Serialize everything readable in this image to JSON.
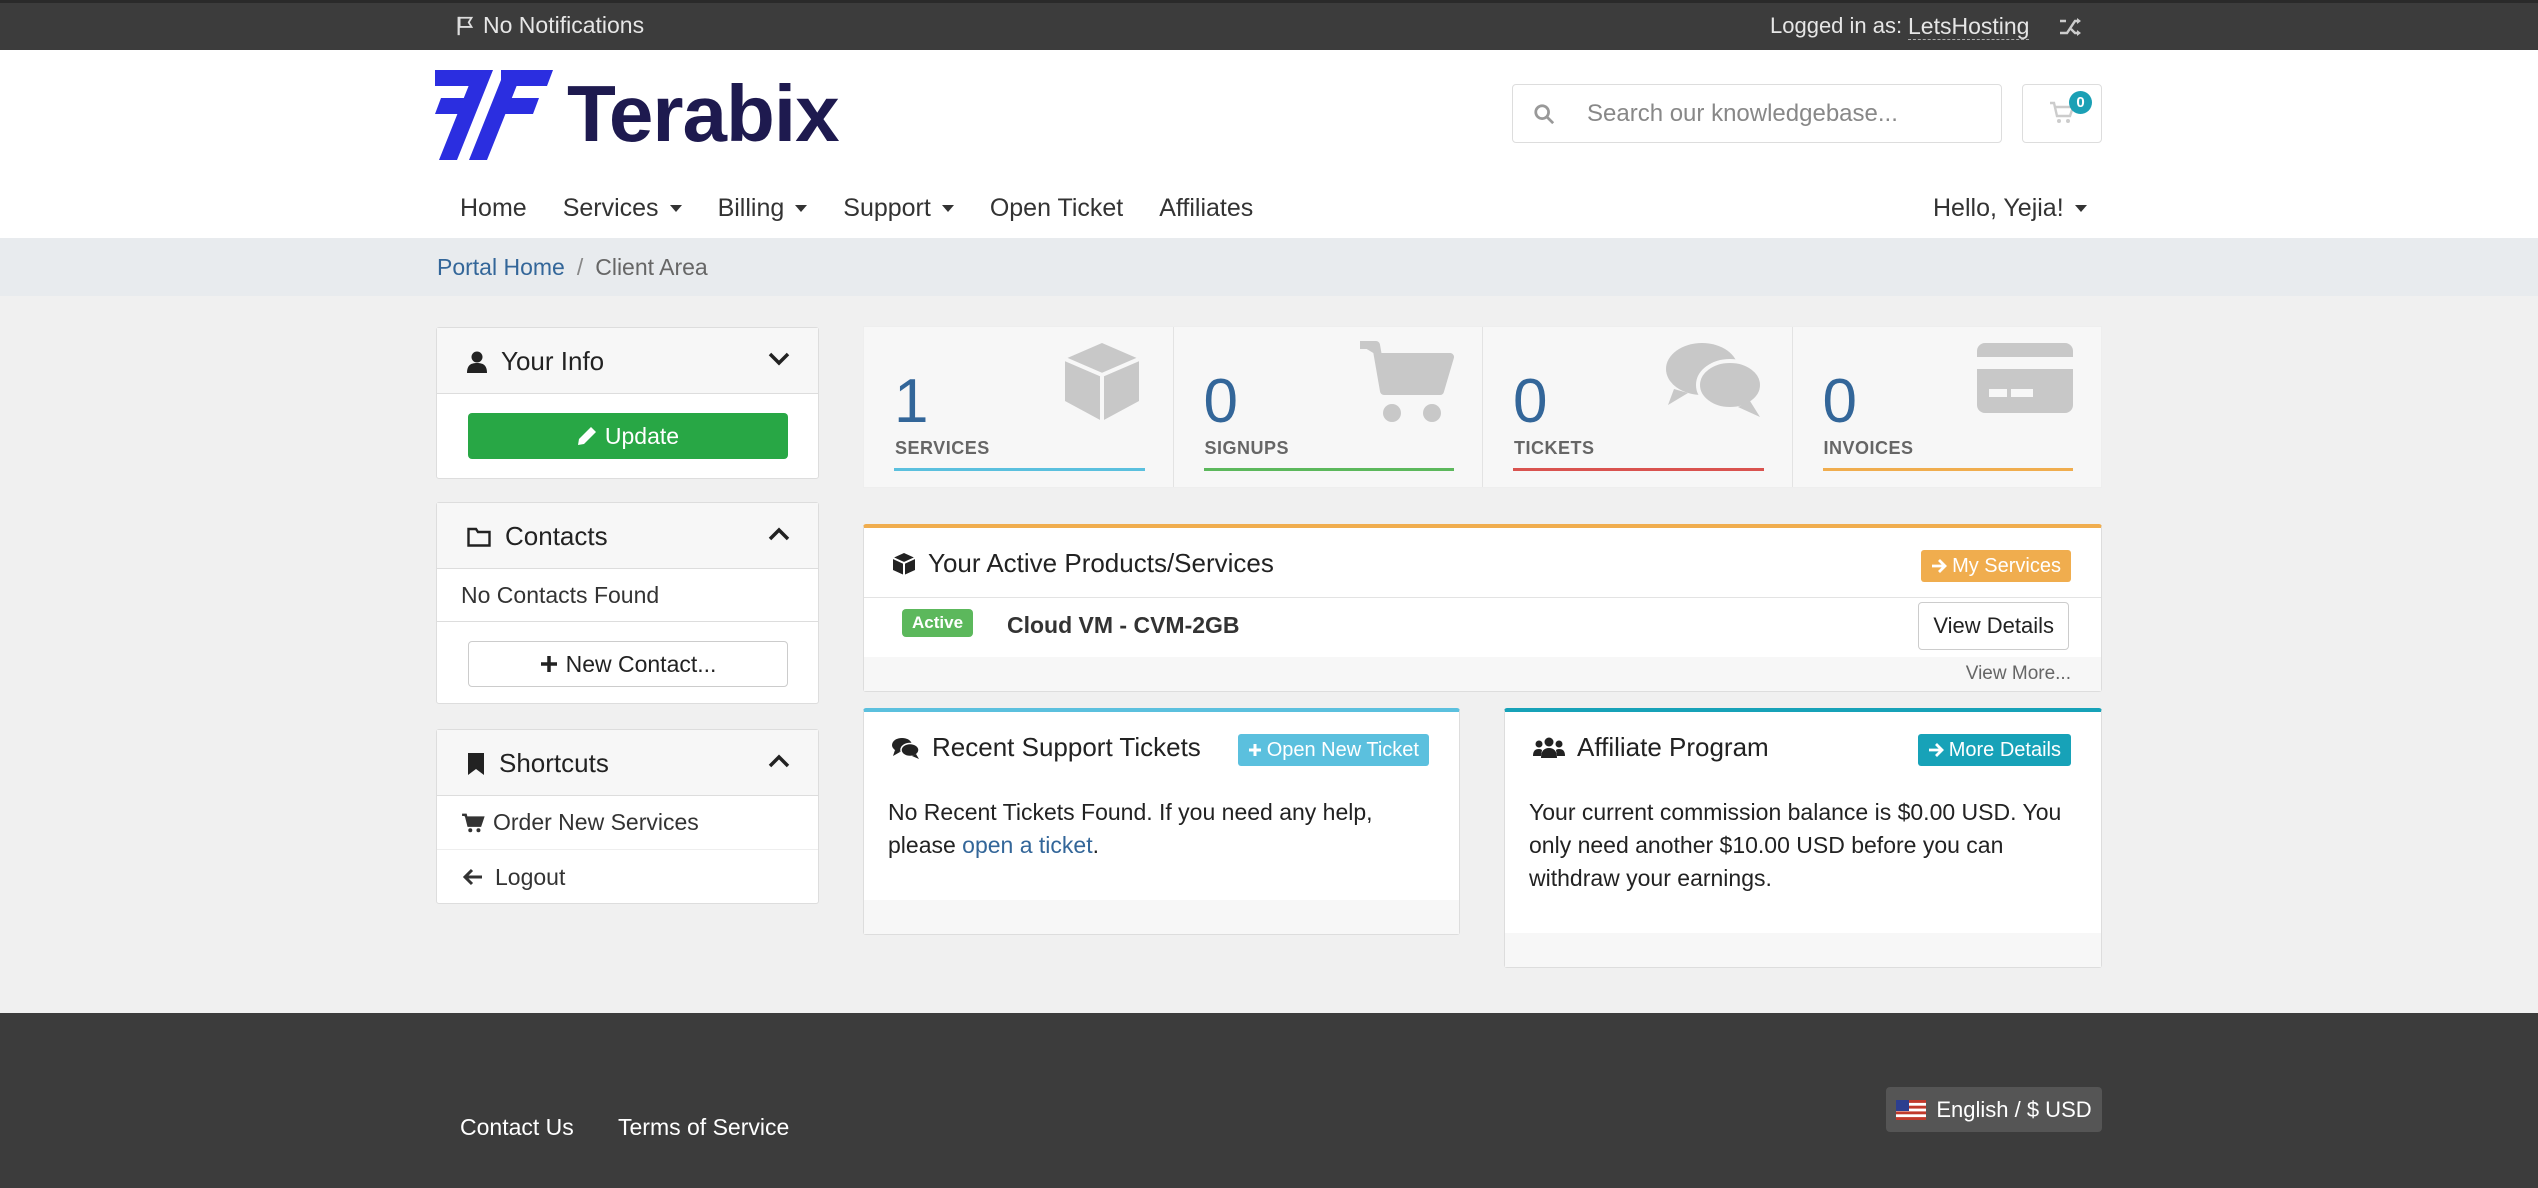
{
  "topbar": {
    "notifications": "No Notifications",
    "logged_in_label": "Logged in as:",
    "username": "LetsHosting"
  },
  "header": {
    "brand": "Terabix",
    "search_placeholder": "Search our knowledgebase...",
    "cart_count": "0"
  },
  "nav": {
    "items": [
      {
        "label": "Home",
        "dropdown": false
      },
      {
        "label": "Services",
        "dropdown": true
      },
      {
        "label": "Billing",
        "dropdown": true
      },
      {
        "label": "Support",
        "dropdown": true
      },
      {
        "label": "Open Ticket",
        "dropdown": false
      },
      {
        "label": "Affiliates",
        "dropdown": false
      }
    ],
    "user_menu": "Hello, Yejia!"
  },
  "breadcrumb": {
    "home": "Portal Home",
    "separator": "/",
    "current": "Client Area"
  },
  "sidebar": {
    "your_info": {
      "title": "Your Info",
      "update_label": "Update"
    },
    "contacts": {
      "title": "Contacts",
      "empty": "No Contacts Found",
      "new_label": "New Contact..."
    },
    "shortcuts": {
      "title": "Shortcuts",
      "items": [
        "Order New Services",
        "Logout"
      ]
    }
  },
  "stats": [
    {
      "value": "1",
      "label": "SERVICES",
      "color": "#5bc0de"
    },
    {
      "value": "0",
      "label": "SIGNUPS",
      "color": "#5cb85c"
    },
    {
      "value": "0",
      "label": "TICKETS",
      "color": "#d9534f"
    },
    {
      "value": "0",
      "label": "INVOICES",
      "color": "#f0ad4e"
    }
  ],
  "products_panel": {
    "title": "Your Active Products/Services",
    "button": "My Services",
    "status": "Active",
    "product": "Cloud VM - CVM-2GB",
    "details_button": "View Details",
    "view_more": "View More..."
  },
  "tickets_panel": {
    "title": "Recent Support Tickets",
    "button": "Open New Ticket",
    "text": "No Recent Tickets Found. If you need any help, please",
    "link": "open a ticket",
    "suffix": "."
  },
  "affiliate_panel": {
    "title": "Affiliate Program",
    "button": "More Details",
    "text": "Your current commission balance is $0.00 USD. You only need another $10.00 USD before you can withdraw your earnings."
  },
  "footer": {
    "links": [
      "Contact Us",
      "Terms of Service"
    ],
    "language": "English / $ USD"
  },
  "colors": {
    "brand": "#1e1a4f",
    "brand_accent": "#2b2ee0",
    "link": "#336699",
    "success": "#28a745",
    "warning": "#f0ad4e",
    "info": "#5bc0de",
    "teal": "#17a2b8"
  }
}
